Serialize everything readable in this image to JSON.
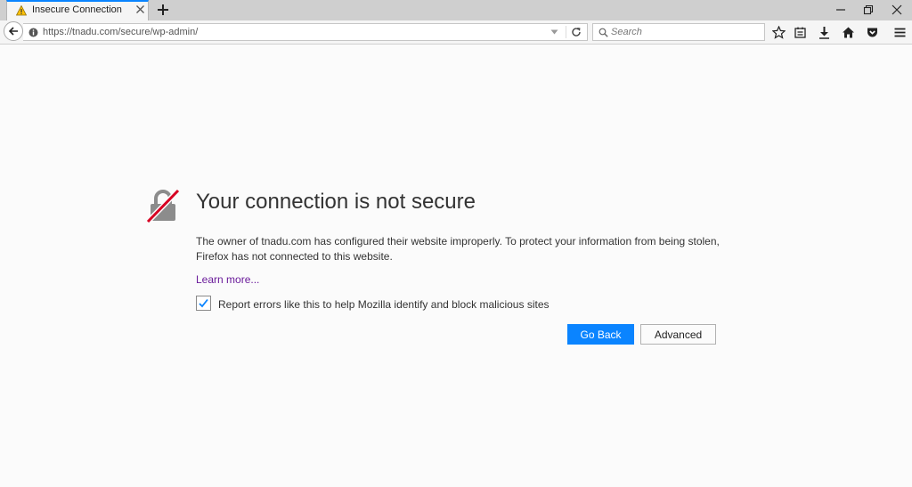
{
  "tab": {
    "title": "Insecure Connection"
  },
  "navbar": {
    "url": "https://tnadu.com/secure/wp-admin/",
    "search_placeholder": "Search"
  },
  "page": {
    "title": "Your connection is not secure",
    "description": "The owner of tnadu.com has configured their website improperly. To protect your information from being stolen, Firefox has not connected to this website.",
    "learn_more": "Learn more...",
    "report_label": "Report errors like this to help Mozilla identify and block malicious sites",
    "report_checked": true,
    "go_back": "Go Back",
    "advanced": "Advanced"
  },
  "colors": {
    "accent": "#0a84ff",
    "link": "#6a1b9a",
    "warning": "#ffc107",
    "strike": "#d70022"
  },
  "icons": [
    "warning-icon",
    "close-icon",
    "plus-icon",
    "minimize-icon",
    "restore-icon",
    "close-window-icon",
    "back-arrow-icon",
    "info-icon",
    "dropdown-icon",
    "reload-icon",
    "search-icon",
    "star-icon",
    "reading-list-icon",
    "download-icon",
    "home-icon",
    "pocket-icon",
    "menu-icon",
    "broken-lock-icon",
    "checkmark-icon"
  ]
}
